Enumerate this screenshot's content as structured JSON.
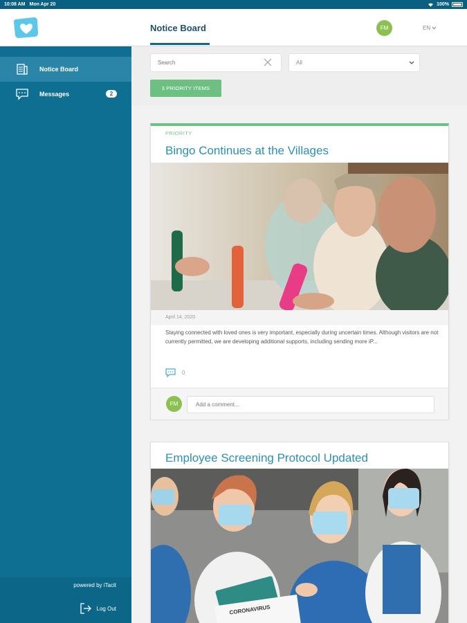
{
  "status_bar": {
    "time": "10:08 AM",
    "date": "Mon Apr 20",
    "battery": "100%"
  },
  "header": {
    "nav_title": "Notice Board",
    "user_initials": "FM",
    "language": "EN"
  },
  "sidebar": {
    "items": [
      {
        "label": "Notice Board",
        "icon": "notice-board-icon",
        "active": true
      },
      {
        "label": "Messages",
        "icon": "messages-icon",
        "badge": "2"
      }
    ],
    "powered_by": "powered by iTacit",
    "logout_label": "Log Out"
  },
  "filters": {
    "search_placeholder": "Search",
    "category_value": "All",
    "priority_button": "3 PRIORITY ITEMS"
  },
  "posts": [
    {
      "tag": "PRIORITY",
      "title": "Bingo Continues at the Villages",
      "image": "seniors-playing-bingo-photo",
      "date": "April 14, 2020",
      "excerpt": "Staying connected with loved ones is very important, especially during uncertain times. Although visitors are not currently permitted, we are developing additional supports, including sending more iP...",
      "comment_count": "0",
      "comment_avatar": "FM",
      "comment_placeholder": "Add a comment..."
    },
    {
      "title": "Employee Screening Protocol Updated",
      "image": "medical-staff-masks-photo",
      "image_text": "CORONAVIRUS"
    }
  ],
  "colors": {
    "sidebar": "#0f6f93",
    "accent": "#2c8fb7",
    "priority_green": "#6dbf82",
    "avatar_green": "#8cc152"
  }
}
